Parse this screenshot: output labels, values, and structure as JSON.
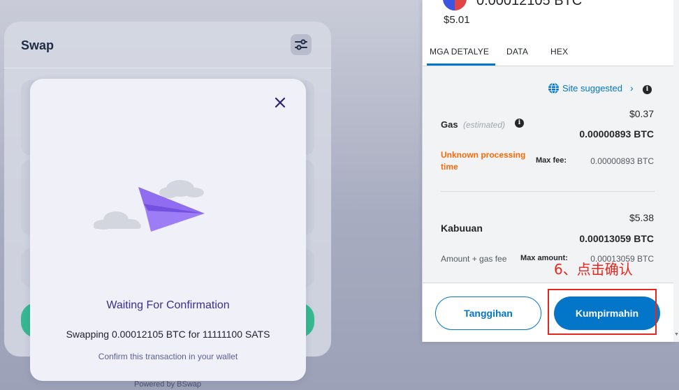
{
  "swap": {
    "title": "Swap",
    "powered_by": "Powered by BSwap"
  },
  "modal": {
    "title": "Waiting For Confirmation",
    "message": "Swapping 0.00012105 BTC for 11111100 SATS",
    "hint": "Confirm this transaction in your wallet"
  },
  "wallet": {
    "amount_top": "0.00012105 BTC",
    "usd": "$5.01",
    "tabs": [
      "MGA DETALYE",
      "DATA",
      "HEX"
    ],
    "active_tab": "MGA DETALYE",
    "site_suggested": "Site suggested",
    "gas": {
      "label": "Gas",
      "estimated": "(estimated)",
      "usd": "$0.37",
      "btc": "0.00000893 BTC",
      "unknown_processing": "Unknown processing time",
      "max_fee_label": "Max fee:",
      "max_fee_value": "0.00000893 BTC"
    },
    "total": {
      "label": "Kabuuan",
      "usd": "$5.38",
      "btc": "0.00013059 BTC",
      "amount_gas_label": "Amount + gas fee",
      "max_amount_label": "Max amount:",
      "max_amount_value": "0.00013059 BTC"
    },
    "buttons": {
      "cancel": "Tanggihan",
      "confirm": "Kumpirmahin"
    }
  },
  "annotation": {
    "text": "6、点击确认",
    "color": "#e8261c"
  },
  "colors": {
    "accent": "#0376c9",
    "warning": "#f66a0a",
    "modal_title": "#3a2f8c",
    "swap_green": "#36b892"
  },
  "icons": [
    "settings-sliders-icon",
    "close-icon",
    "paper-plane-icon",
    "cloud-icon",
    "globe-icon",
    "info-icon",
    "chevron-right-icon",
    "coin-icon"
  ]
}
